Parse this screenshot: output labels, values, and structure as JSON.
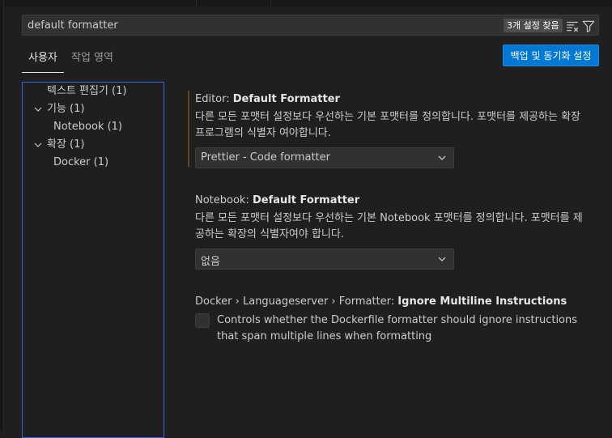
{
  "search": {
    "value": "default formatter",
    "result_count": "3개 설정 찾음"
  },
  "icons": {
    "clear_filter": "clear-filter-icon",
    "filter": "filter-icon",
    "chevron_down": "chevron-down-icon"
  },
  "tabs": [
    {
      "label": "사용자",
      "active": true
    },
    {
      "label": "작업 영역",
      "active": false
    }
  ],
  "sync_button": {
    "label": "백업 및 동기화 설정"
  },
  "toc": {
    "items": [
      {
        "label": "텍스트 편집기 (1)",
        "expandable": false
      },
      {
        "label": "기능 (1)",
        "expandable": true
      },
      {
        "label": "Notebook (1)",
        "expandable": false
      },
      {
        "label": "확장 (1)",
        "expandable": true
      },
      {
        "label": "Docker (1)",
        "expandable": false
      }
    ]
  },
  "settings": [
    {
      "category": "Editor: ",
      "name": "Default Formatter",
      "description": "다른 모든 포맷터 설정보다 우선하는 기본 포맷터를 정의합니다. 포맷터를 제공하는 확장 프로그램의 식별자 여야합니다.",
      "value": "Prettier - Code formatter"
    },
    {
      "category": "Notebook: ",
      "name": "Default Formatter",
      "description": "다른 모든 포맷터 설정보다 우선하는 기본 Notebook 포맷터를 정의합니다. 포맷터를 제공하는 확장의 식별자여야 합니다.",
      "value": "없음"
    },
    {
      "category": "Docker › Languageserver › Formatter: ",
      "name": "Ignore Multiline Instructions",
      "description": "Controls whether the Dockerfile formatter should ignore instructions that span multiple lines when formatting",
      "checked": false
    }
  ],
  "colors": {
    "background": "#1f1f1f",
    "accent": "#0078d4",
    "focus_border": "#2f63d9",
    "modified_bar": "#5a4a1d"
  }
}
